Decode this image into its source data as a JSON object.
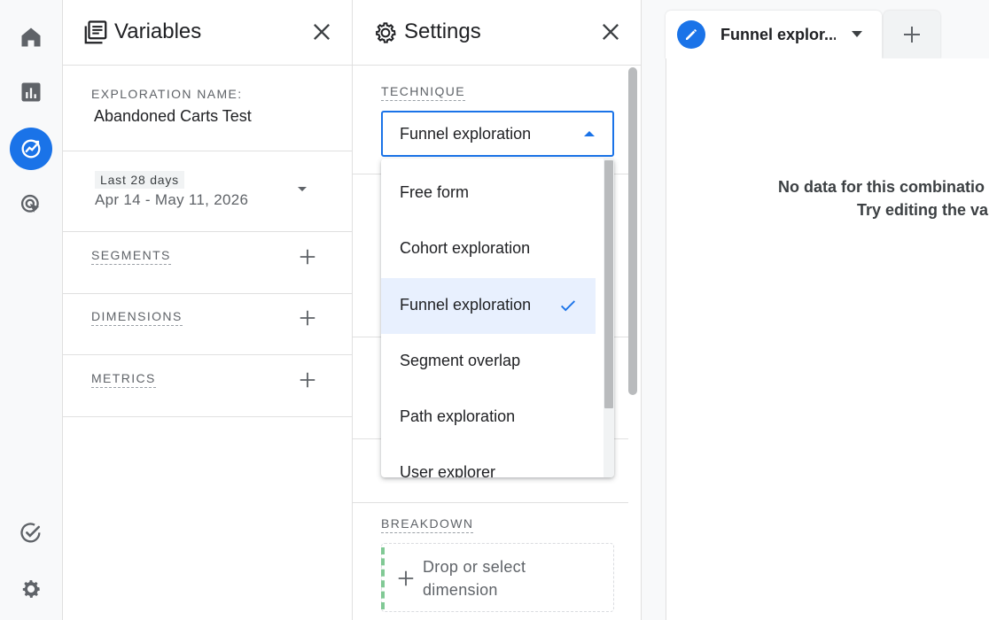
{
  "colors": {
    "accent": "#1a73e8",
    "selected_bg": "#e8f0fe",
    "rail_bg": "#f8f9fa"
  },
  "rail": [
    {
      "icon": "home-icon"
    },
    {
      "icon": "reports-icon"
    },
    {
      "icon": "explore-icon",
      "active": true
    },
    {
      "icon": "advertising-icon"
    },
    {
      "icon": "configure-icon"
    },
    {
      "icon": "admin-gear-icon"
    }
  ],
  "variables": {
    "title": "Variables",
    "exploration_name_label": "EXPLORATION NAME:",
    "exploration_name": "Abandoned Carts Test",
    "date_chip": "Last 28 days",
    "date_range": "Apr 14 - May 11, 2026",
    "segments_label": "SEGMENTS",
    "dimensions_label": "DIMENSIONS",
    "metrics_label": "METRICS"
  },
  "settings": {
    "title": "Settings",
    "technique_label": "TECHNIQUE",
    "technique_value": "Funnel exploration",
    "breakdown_label": "BREAKDOWN",
    "drop_line1": "Drop or select",
    "drop_line2": "dimension"
  },
  "technique_menu": {
    "options": [
      "Free form",
      "Cohort exploration",
      "Funnel exploration",
      "Segment overlap",
      "Path exploration",
      "User explorer"
    ],
    "selected": "Funnel exploration"
  },
  "canvas": {
    "tab_name": "Funnel explor...",
    "nodata_line1": "No data for this combinatio",
    "nodata_line2": "Try editing the va"
  }
}
